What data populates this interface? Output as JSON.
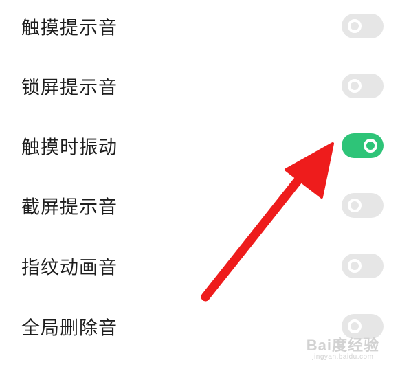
{
  "settings": [
    {
      "label": "触摸提示音",
      "enabled": false
    },
    {
      "label": "锁屏提示音",
      "enabled": false
    },
    {
      "label": "触摸时振动",
      "enabled": true
    },
    {
      "label": "截屏提示音",
      "enabled": false
    },
    {
      "label": "指纹动画音",
      "enabled": false
    },
    {
      "label": "全局删除音",
      "enabled": false
    }
  ],
  "annotation": {
    "type": "arrow",
    "color": "#ee1c1c",
    "points_to": "触摸时振动"
  },
  "colors": {
    "toggle_on": "#2ec478",
    "toggle_off": "#e6e6e6",
    "label_text": "#1e1e1e"
  },
  "watermark": {
    "brand": "Bai度经验",
    "url": "jingyan.baidu.com"
  }
}
